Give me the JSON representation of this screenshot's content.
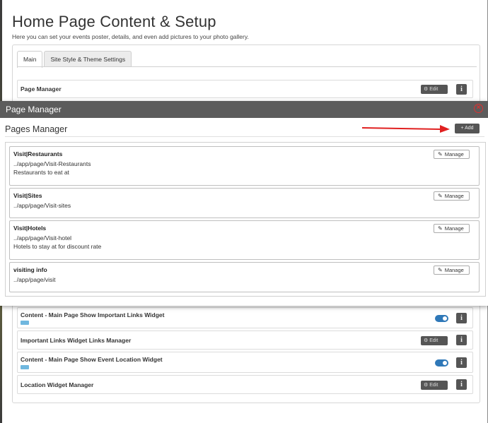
{
  "page": {
    "title": "Home Page Content & Setup",
    "subtitle": "Here you can set your events poster, details, and even add pictures to your photo gallery.",
    "tabs": [
      {
        "label": "Main",
        "active": true
      },
      {
        "label": "Site Style & Theme Settings",
        "active": false
      }
    ]
  },
  "settings_rows": [
    {
      "label": "Page Manager",
      "control": "edit",
      "edit_label": "Edit",
      "info_label": "i"
    },
    {
      "label": "Content - Main Page Show Important Links Widget",
      "control": "toggle",
      "toggle_on": true,
      "info_label": "i"
    },
    {
      "label": "Important Links Widget Links Manager",
      "control": "edit",
      "edit_label": "Edit",
      "info_label": "i"
    },
    {
      "label": "Content - Main Page Show Event Location Widget",
      "control": "toggle",
      "toggle_on": true,
      "info_label": "i"
    },
    {
      "label": "Location Widget Manager",
      "control": "edit",
      "edit_label": "Edit",
      "info_label": "i"
    }
  ],
  "modal": {
    "title": "Page Manager",
    "heading": "Pages Manager",
    "add_label": "+ Add",
    "close_icon": "close-circle-icon",
    "pages": [
      {
        "title": "Visit|Restaurants",
        "path": "../app/page/Visit-Restaurants",
        "description": "Restaurants to eat at",
        "manage_label": "Manage"
      },
      {
        "title": "Visit|Sites",
        "path": "../app/page/Visit-sites",
        "description": "",
        "manage_label": "Manage"
      },
      {
        "title": "Visit|Hotels",
        "path": "../app/page/Visit-hotel",
        "description": "Hotels to stay at for discount rate",
        "manage_label": "Manage"
      },
      {
        "title": "visiting info",
        "path": "../app/page/visit",
        "description": "",
        "manage_label": "Manage"
      }
    ]
  },
  "colors": {
    "modal_header": "#5c5c5c",
    "button_dark": "#555555",
    "toggle_on": "#2f78b8",
    "close_red": "#e03030",
    "annotation_arrow": "#e02020"
  }
}
